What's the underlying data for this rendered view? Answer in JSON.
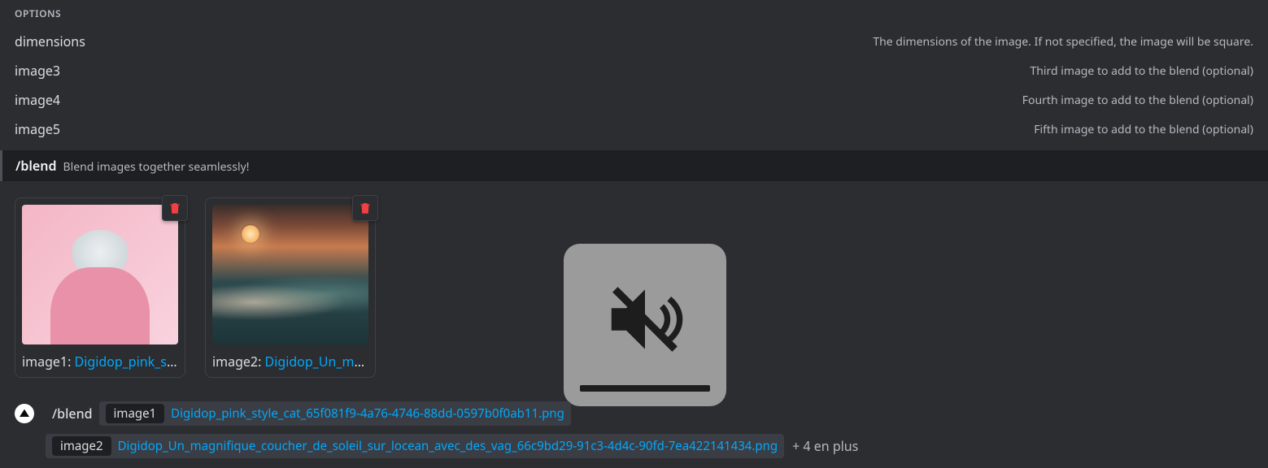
{
  "options": {
    "header": "OPTIONS",
    "items": [
      {
        "name": "dimensions",
        "desc": "The dimensions of the image. If not specified, the image will be square."
      },
      {
        "name": "image3",
        "desc": "Third image to add to the blend (optional)"
      },
      {
        "name": "image4",
        "desc": "Fourth image to add to the blend (optional)"
      },
      {
        "name": "image5",
        "desc": "Fifth image to add to the blend (optional)"
      }
    ]
  },
  "command_hint": {
    "name": "/blend",
    "desc": "Blend images together seamlessly!"
  },
  "attachments": [
    {
      "key": "image1",
      "filename": "Digidop_pink_style…"
    },
    {
      "key": "image2",
      "filename": "Digidop_Un_magni…"
    }
  ],
  "input": {
    "command": "/blend",
    "params": [
      {
        "key": "image1",
        "value": "Digidop_pink_style_cat_65f081f9-4a76-4746-88dd-0597b0f0ab11.png"
      },
      {
        "key": "image2",
        "value": "Digidop_Un_magnifique_coucher_de_soleil_sur_locean_avec_des_vag_66c9bd29-91c3-4d4c-90fd-7ea422141434.png"
      }
    ],
    "more": "+ 4 en plus"
  },
  "separators": {
    "colon": ": "
  }
}
